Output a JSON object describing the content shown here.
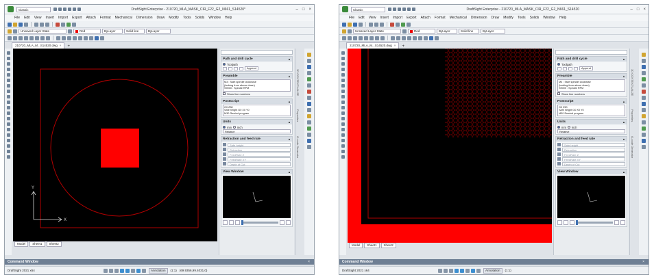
{
  "windows": [
    {
      "id": "left",
      "title": "DraftSight Enterprise - 210720_MLA_MASK_CIR_F22_G2_N661_S14520*",
      "workspace": "Classic",
      "menu": [
        "File",
        "Edit",
        "View",
        "Insert",
        "Import",
        "Export",
        "Attach",
        "Format",
        "Mechanical",
        "Dimension",
        "Draw",
        "Modify",
        "Tools",
        "Solids",
        "Window",
        "Help"
      ],
      "layer_state": "Unsaved Layer State",
      "color": "Red",
      "linetype": "ByLayer",
      "lineweight": "Solid line",
      "lineweight2": "ByLayer",
      "doc_tab": "210720_MLA_M...S14520.dwg",
      "layout_tabs": [
        "Model",
        "Sheet1",
        "Sheet2"
      ],
      "command_window": "Command Window",
      "status_app": "DraftSight 2021 x64",
      "annotation": "Annotation",
      "scale": "(1:1)",
      "coords": "(69.9356,99.4031,0)",
      "panel": {
        "path_drill": {
          "title": "Path and drill cycle",
          "toolpath": "Toolpath",
          "append": "Append"
        },
        "preamble": {
          "title": "Preamble",
          "lines": [
            "M3 : Start spindle clockwise",
            "(looking from above down)",
            "S9000 : Spindle RPM"
          ],
          "show_line_numbers": "Show line numbers"
        },
        "postscript": {
          "title": "Postscript",
          "lines": [
            "G0 Z50",
            "Safe height G0 X0 Y0",
            "M30 Rewind program"
          ]
        },
        "units": {
          "title": "Units",
          "mm": "mm",
          "inch": "inch",
          "mode": "Relative"
        },
        "retraction": {
          "title": "Retraction and feed rate",
          "fields": [
            "Safe height",
            "Retraction",
            "FeedRate Z",
            "FeedRate XY",
            "Depth of Cut"
          ]
        },
        "view_window": {
          "title": "View Window"
        }
      },
      "side_labels": [
        "3D CONTEXTUALIZE",
        "Properties",
        "G-code Generator"
      ]
    },
    {
      "id": "right",
      "title": "DraftSight Enterprise - 210720_MLA_MASK_CIR_F22_G2_N661_S14520",
      "workspace": "Classic",
      "menu": [
        "File",
        "Edit",
        "View",
        "Insert",
        "Import",
        "Export",
        "Attach",
        "Format",
        "Mechanical",
        "Dimension",
        "Draw",
        "Modify",
        "Tools",
        "Solids",
        "Window",
        "Help"
      ],
      "layer_state": "Unsaved Layer State",
      "color": "Red",
      "linetype": "ByLayer",
      "lineweight": "Solid line",
      "lineweight2": "ByLayer",
      "doc_tab": "210720_MLA_M...S14520.dwg",
      "layout_tabs": [
        "Model",
        "Sheet1",
        "Sheet2"
      ],
      "command_window": "Command Window",
      "status_app": "DraftSight 2021 x64",
      "annotation": "Annotation",
      "scale": "(1:1)",
      "coords": "",
      "panel": {
        "path_drill": {
          "title": "Path and drill cycle",
          "toolpath": "Toolpath",
          "append": "Append"
        },
        "preamble": {
          "title": "Preamble",
          "lines": [
            "M3 : Start spindle clockwise",
            "(looking from above down)",
            "S9000 : Spindle RPM"
          ],
          "show_line_numbers": "Show line numbers"
        },
        "postscript": {
          "title": "Postscript",
          "lines": [
            "G0 Z50",
            "Safe height G0 X0 Y0",
            "M30 Rewind program"
          ]
        },
        "units": {
          "title": "Units",
          "mm": "mm",
          "inch": "inch",
          "mode": "Relative"
        },
        "retraction": {
          "title": "Retraction and feed rate",
          "fields": [
            "Safe height",
            "Retraction",
            "FeedRate Z",
            "FeedRate XY",
            "Depth of Cut"
          ]
        },
        "view_window": {
          "title": "View Window"
        }
      },
      "side_labels": [
        "3D CONTEXTUALIZE",
        "Properties",
        "G-code Generator"
      ]
    }
  ],
  "colors": {
    "canvas_bg": "#000000",
    "entity_red": "#ff0000",
    "outline_red": "#b00000",
    "axis_white": "#d8d8d8"
  }
}
